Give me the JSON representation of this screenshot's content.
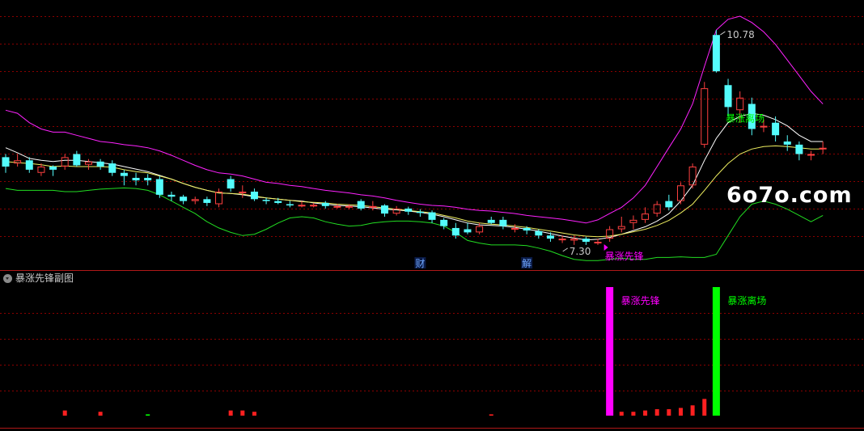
{
  "watermark": "6o7o.com",
  "subpanel_title": "暴涨先锋副图",
  "colors": {
    "up": "#ff4040",
    "down": "#54fcfc",
    "upper_band": "#ff22ff",
    "lower_band": "#22dd22",
    "mid_line": "#ffffff",
    "ma_line": "#f0f060",
    "signal_buy": "#ff00ff",
    "signal_sell": "#00ff00",
    "grid": "#8b0000"
  },
  "chart_data": [
    {
      "type": "candlestick",
      "title": "",
      "ylim": [
        7.0,
        11.0
      ],
      "annotations": {
        "high_label": {
          "text": "10.78",
          "index": 60
        },
        "low_label": {
          "text": "7.30",
          "index": 48
        },
        "buy_label": {
          "text": "暴涨先锋",
          "index": 51
        },
        "sell_label": {
          "text": "暴涨离场",
          "index": 61
        },
        "event_labels": [
          {
            "text": "财",
            "index": 35
          },
          {
            "text": "解",
            "index": 44
          }
        ]
      },
      "candles": [
        [
          8.75,
          8.6,
          8.8,
          8.5
        ],
        [
          8.65,
          8.7,
          8.8,
          8.6
        ],
        [
          8.7,
          8.55,
          8.75,
          8.5
        ],
        [
          8.5,
          8.6,
          8.65,
          8.45
        ],
        [
          8.6,
          8.55,
          8.62,
          8.45
        ],
        [
          8.6,
          8.75,
          8.8,
          8.55
        ],
        [
          8.8,
          8.62,
          8.85,
          8.6
        ],
        [
          8.63,
          8.68,
          8.72,
          8.55
        ],
        [
          8.68,
          8.6,
          8.72,
          8.55
        ],
        [
          8.65,
          8.5,
          8.7,
          8.45
        ],
        [
          8.5,
          8.45,
          8.55,
          8.3
        ],
        [
          8.42,
          8.38,
          8.5,
          8.3
        ],
        [
          8.42,
          8.38,
          8.48,
          8.3
        ],
        [
          8.4,
          8.15,
          8.45,
          8.1
        ],
        [
          8.15,
          8.12,
          8.2,
          8.05
        ],
        [
          8.12,
          8.05,
          8.15,
          8.0
        ],
        [
          8.05,
          8.08,
          8.12,
          8.0
        ],
        [
          8.08,
          8.02,
          8.12,
          7.97
        ],
        [
          8.0,
          8.2,
          8.25,
          7.95
        ],
        [
          8.4,
          8.25,
          8.45,
          8.2
        ],
        [
          8.2,
          8.2,
          8.3,
          8.1
        ],
        [
          8.2,
          8.08,
          8.25,
          8.05
        ],
        [
          8.07,
          8.05,
          8.1,
          8.0
        ],
        [
          8.05,
          8.02,
          8.1,
          8.0
        ],
        [
          8.0,
          7.98,
          8.05,
          7.95
        ],
        [
          7.98,
          7.99,
          8.05,
          7.95
        ],
        [
          7.97,
          7.99,
          8.02,
          7.95
        ],
        [
          8.02,
          7.97,
          8.05,
          7.93
        ],
        [
          7.97,
          7.97,
          8.0,
          7.93
        ],
        [
          7.95,
          7.97,
          8.0,
          7.92
        ],
        [
          8.05,
          7.93,
          8.08,
          7.9
        ],
        [
          7.95,
          7.97,
          8.05,
          7.9
        ],
        [
          7.98,
          7.85,
          8.0,
          7.8
        ],
        [
          7.85,
          7.93,
          7.97,
          7.82
        ],
        [
          7.93,
          7.88,
          7.96,
          7.83
        ],
        [
          7.88,
          7.86,
          7.92,
          7.8
        ],
        [
          7.87,
          7.75,
          7.9,
          7.7
        ],
        [
          7.75,
          7.65,
          7.78,
          7.6
        ],
        [
          7.62,
          7.5,
          7.7,
          7.45
        ],
        [
          7.6,
          7.55,
          7.7,
          7.52
        ],
        [
          7.55,
          7.65,
          7.7,
          7.52
        ],
        [
          7.75,
          7.7,
          7.8,
          7.68
        ],
        [
          7.75,
          7.65,
          7.8,
          7.6
        ],
        [
          7.62,
          7.62,
          7.68,
          7.55
        ],
        [
          7.62,
          7.58,
          7.65,
          7.52
        ],
        [
          7.57,
          7.5,
          7.6,
          7.45
        ],
        [
          7.5,
          7.45,
          7.55,
          7.4
        ],
        [
          7.45,
          7.45,
          7.5,
          7.38
        ],
        [
          7.42,
          7.45,
          7.5,
          7.35
        ],
        [
          7.45,
          7.4,
          7.48,
          7.35
        ],
        [
          7.4,
          7.4,
          7.45,
          7.35
        ],
        [
          7.45,
          7.6,
          7.65,
          7.4
        ],
        [
          7.6,
          7.65,
          7.8,
          7.55
        ],
        [
          7.7,
          7.75,
          7.82,
          7.6
        ],
        [
          7.75,
          7.85,
          7.95,
          7.7
        ],
        [
          7.85,
          8.0,
          8.05,
          7.8
        ],
        [
          8.05,
          7.95,
          8.15,
          7.9
        ],
        [
          8.05,
          8.3,
          8.35,
          8.0
        ],
        [
          8.3,
          8.6,
          8.65,
          8.25
        ],
        [
          8.95,
          9.85,
          9.95,
          8.9
        ],
        [
          10.7,
          10.12,
          10.78,
          10.1
        ],
        [
          9.9,
          9.55,
          10.0,
          9.4
        ],
        [
          9.5,
          9.7,
          9.8,
          9.3
        ],
        [
          9.6,
          9.2,
          9.7,
          9.1
        ],
        [
          9.25,
          9.25,
          9.35,
          9.15
        ],
        [
          9.3,
          9.1,
          9.4,
          9.0
        ],
        [
          9.0,
          8.95,
          9.1,
          8.85
        ],
        [
          8.95,
          8.8,
          9.0,
          8.7
        ],
        [
          8.8,
          8.8,
          8.85,
          8.7
        ],
        [
          8.9,
          8.9,
          9.0,
          8.8
        ]
      ],
      "upper_band": [
        9.5,
        9.45,
        9.3,
        9.2,
        9.15,
        9.15,
        9.1,
        9.05,
        9.0,
        8.98,
        8.95,
        8.93,
        8.9,
        8.85,
        8.78,
        8.7,
        8.62,
        8.55,
        8.5,
        8.48,
        8.45,
        8.4,
        8.35,
        8.33,
        8.3,
        8.28,
        8.25,
        8.22,
        8.2,
        8.18,
        8.15,
        8.13,
        8.1,
        8.06,
        8.03,
        8.0,
        7.98,
        7.97,
        7.95,
        7.92,
        7.9,
        7.89,
        7.87,
        7.85,
        7.82,
        7.8,
        7.78,
        7.76,
        7.73,
        7.7,
        7.75,
        7.85,
        7.95,
        8.1,
        8.3,
        8.6,
        8.9,
        9.2,
        9.6,
        10.2,
        10.78,
        10.95,
        11.0,
        10.9,
        10.75,
        10.55,
        10.3,
        10.05,
        9.8,
        9.6
      ],
      "lower_band": [
        8.25,
        8.22,
        8.22,
        8.22,
        8.22,
        8.2,
        8.2,
        8.22,
        8.24,
        8.25,
        8.26,
        8.25,
        8.22,
        8.15,
        8.05,
        7.95,
        7.85,
        7.72,
        7.62,
        7.55,
        7.5,
        7.52,
        7.6,
        7.7,
        7.78,
        7.8,
        7.78,
        7.72,
        7.68,
        7.65,
        7.66,
        7.7,
        7.72,
        7.73,
        7.73,
        7.72,
        7.7,
        7.65,
        7.55,
        7.42,
        7.38,
        7.35,
        7.35,
        7.35,
        7.34,
        7.3,
        7.25,
        7.18,
        7.12,
        7.1,
        7.1,
        7.12,
        7.14,
        7.12,
        7.12,
        7.15,
        7.15,
        7.16,
        7.15,
        7.15,
        7.2,
        7.5,
        7.8,
        8.0,
        8.05,
        8.0,
        7.92,
        7.82,
        7.72,
        7.82
      ],
      "mid_line": [
        8.9,
        8.82,
        8.73,
        8.7,
        8.68,
        8.7,
        8.7,
        8.68,
        8.66,
        8.64,
        8.6,
        8.56,
        8.52,
        8.46,
        8.4,
        8.33,
        8.27,
        8.22,
        8.18,
        8.17,
        8.15,
        8.12,
        8.1,
        8.08,
        8.06,
        8.05,
        8.02,
        8.0,
        7.98,
        7.97,
        7.96,
        7.94,
        7.92,
        7.91,
        7.89,
        7.87,
        7.84,
        7.8,
        7.75,
        7.7,
        7.67,
        7.66,
        7.65,
        7.63,
        7.6,
        7.57,
        7.53,
        7.49,
        7.46,
        7.43,
        7.44,
        7.47,
        7.52,
        7.58,
        7.64,
        7.73,
        7.85,
        8.05,
        8.3,
        8.7,
        9.05,
        9.3,
        9.4,
        9.45,
        9.42,
        9.35,
        9.25,
        9.1,
        9.0,
        9.0
      ],
      "ma_line": [
        8.68,
        8.66,
        8.65,
        8.63,
        8.6,
        8.61,
        8.6,
        8.6,
        8.6,
        8.59,
        8.55,
        8.52,
        8.5,
        8.45,
        8.4,
        8.33,
        8.27,
        8.22,
        8.18,
        8.17,
        8.16,
        8.13,
        8.1,
        8.08,
        8.06,
        8.04,
        8.03,
        8.02,
        8.0,
        7.99,
        7.98,
        7.96,
        7.94,
        7.92,
        7.9,
        7.88,
        7.86,
        7.82,
        7.78,
        7.73,
        7.7,
        7.68,
        7.67,
        7.65,
        7.63,
        7.6,
        7.57,
        7.54,
        7.51,
        7.49,
        7.48,
        7.49,
        7.52,
        7.56,
        7.6,
        7.66,
        7.74,
        7.86,
        8.0,
        8.22,
        8.45,
        8.65,
        8.8,
        8.88,
        8.92,
        8.93,
        8.92,
        8.9,
        8.88,
        8.88
      ]
    },
    {
      "type": "bar",
      "title": "暴涨先锋副图",
      "ylim": [
        0,
        100
      ],
      "annotations": {
        "buy_label": {
          "text": "暴涨先锋",
          "index": 51
        },
        "sell_label": {
          "text": "暴涨离场",
          "index": 60
        }
      },
      "bars": [
        {
          "index": 5,
          "value": 4,
          "color": "red"
        },
        {
          "index": 8,
          "value": 3,
          "color": "red"
        },
        {
          "index": 12,
          "value": 1,
          "color": "green"
        },
        {
          "index": 19,
          "value": 4,
          "color": "red"
        },
        {
          "index": 20,
          "value": 4,
          "color": "red"
        },
        {
          "index": 21,
          "value": 3,
          "color": "red"
        },
        {
          "index": 41,
          "value": 1,
          "color": "red"
        },
        {
          "index": 51,
          "value": 100,
          "color": "magenta"
        },
        {
          "index": 52,
          "value": 3,
          "color": "red"
        },
        {
          "index": 53,
          "value": 3,
          "color": "red"
        },
        {
          "index": 54,
          "value": 4,
          "color": "red"
        },
        {
          "index": 55,
          "value": 5,
          "color": "red"
        },
        {
          "index": 56,
          "value": 5,
          "color": "red"
        },
        {
          "index": 57,
          "value": 6,
          "color": "red"
        },
        {
          "index": 58,
          "value": 8,
          "color": "red"
        },
        {
          "index": 59,
          "value": 13,
          "color": "red"
        },
        {
          "index": 60,
          "value": 100,
          "color": "green"
        }
      ]
    }
  ]
}
